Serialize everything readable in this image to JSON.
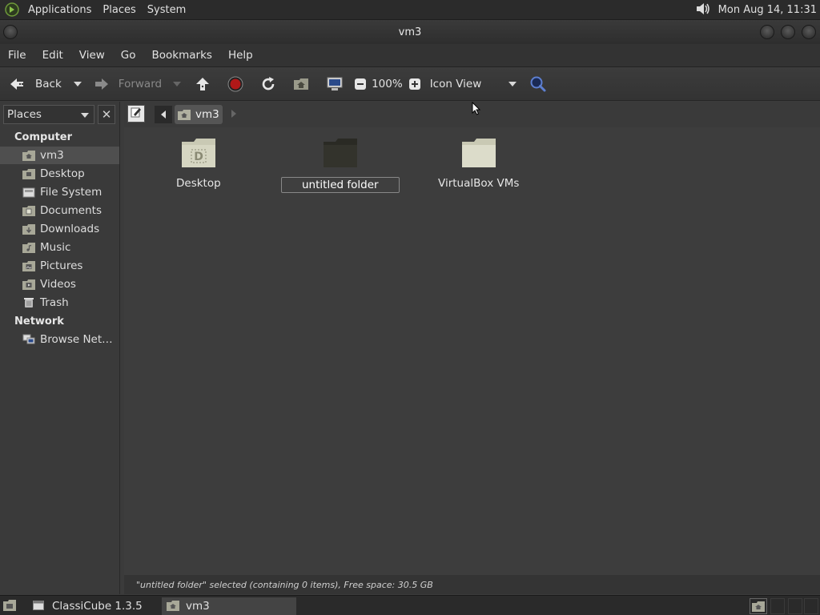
{
  "top_panel": {
    "menus": [
      "Applications",
      "Places",
      "System"
    ],
    "clock": "Mon Aug 14, 11:31"
  },
  "window": {
    "title": "vm3"
  },
  "menubar": {
    "items": [
      "File",
      "Edit",
      "View",
      "Go",
      "Bookmarks",
      "Help"
    ]
  },
  "toolbar": {
    "back_label": "Back",
    "forward_label": "Forward",
    "zoom": "100%",
    "view_mode": "Icon View"
  },
  "sidebar": {
    "selector_label": "Places",
    "sections": [
      {
        "header": "Computer",
        "items": [
          {
            "label": "vm3",
            "icon": "home-folder-icon",
            "selected": true
          },
          {
            "label": "Desktop",
            "icon": "desktop-folder-icon"
          },
          {
            "label": "File System",
            "icon": "filesystem-icon"
          },
          {
            "label": "Documents",
            "icon": "documents-folder-icon"
          },
          {
            "label": "Downloads",
            "icon": "downloads-folder-icon"
          },
          {
            "label": "Music",
            "icon": "music-folder-icon"
          },
          {
            "label": "Pictures",
            "icon": "pictures-folder-icon"
          },
          {
            "label": "Videos",
            "icon": "videos-folder-icon"
          },
          {
            "label": "Trash",
            "icon": "trash-icon"
          }
        ]
      },
      {
        "header": "Network",
        "items": [
          {
            "label": "Browse Net…",
            "icon": "network-icon"
          }
        ]
      }
    ]
  },
  "location": {
    "crumb": "vm3"
  },
  "files": [
    {
      "name": "Desktop",
      "icon": "desktop-folder-icon"
    },
    {
      "name": "untitled folder",
      "icon": "folder-icon",
      "renaming": true
    },
    {
      "name": "VirtualBox VMs",
      "icon": "folder-icon"
    }
  ],
  "status": {
    "text": "\"untitled folder\" selected (containing 0 items), Free space: 30.5 GB"
  },
  "taskbar": {
    "tasks": [
      {
        "label": "ClassiCube 1.3.5",
        "active": false
      },
      {
        "label": "vm3",
        "active": true
      }
    ]
  }
}
